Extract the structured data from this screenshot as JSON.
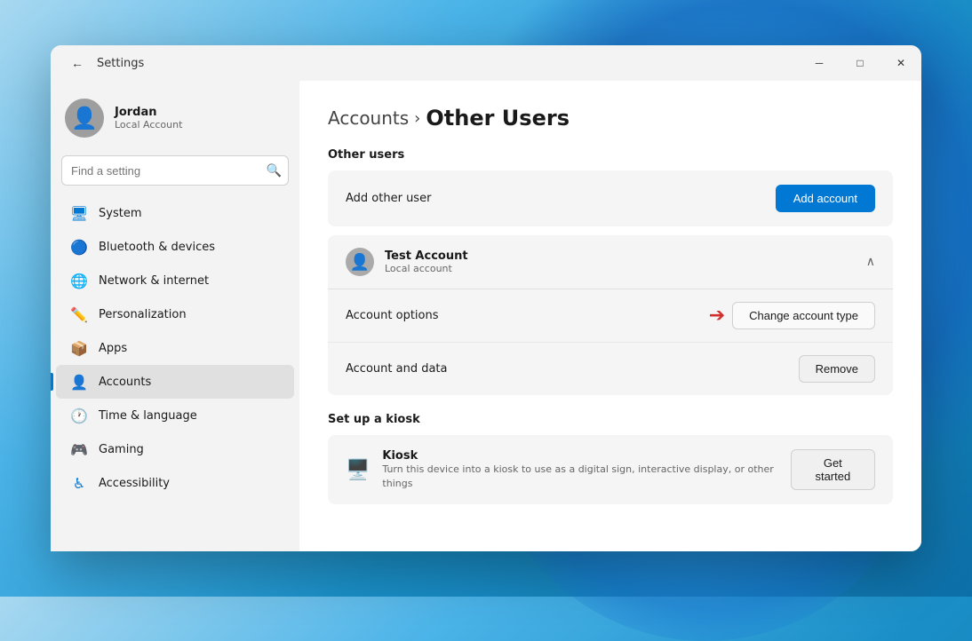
{
  "window": {
    "title": "Settings",
    "minimize_label": "─",
    "maximize_label": "□",
    "close_label": "✕"
  },
  "sidebar": {
    "back_label": "←",
    "title": "Settings",
    "search_placeholder": "Find a setting",
    "user": {
      "name": "Jordan",
      "type": "Local Account"
    },
    "nav_items": [
      {
        "id": "system",
        "label": "System",
        "icon": "🖥"
      },
      {
        "id": "bluetooth",
        "label": "Bluetooth & devices",
        "icon": "🔵"
      },
      {
        "id": "network",
        "label": "Network & internet",
        "icon": "🌐"
      },
      {
        "id": "personalization",
        "label": "Personalization",
        "icon": "✏️"
      },
      {
        "id": "apps",
        "label": "Apps",
        "icon": "📦"
      },
      {
        "id": "accounts",
        "label": "Accounts",
        "icon": "👤",
        "active": true
      },
      {
        "id": "time",
        "label": "Time & language",
        "icon": "🕐"
      },
      {
        "id": "gaming",
        "label": "Gaming",
        "icon": "🎮"
      },
      {
        "id": "accessibility",
        "label": "Accessibility",
        "icon": "♿"
      }
    ]
  },
  "content": {
    "breadcrumb_parent": "Accounts",
    "breadcrumb_separator": "›",
    "breadcrumb_current": "Other Users",
    "other_users_section_title": "Other users",
    "add_user_label": "Add other user",
    "add_account_btn": "Add account",
    "test_account": {
      "name": "Test Account",
      "type": "Local account",
      "options_label": "Account options",
      "change_type_btn": "Change account type",
      "data_label": "Account and data",
      "remove_btn": "Remove"
    },
    "kiosk_section_title": "Set up a kiosk",
    "kiosk": {
      "title": "Kiosk",
      "description": "Turn this device into a kiosk to use as a digital sign, interactive display, or other things",
      "btn_label": "Get started"
    }
  }
}
